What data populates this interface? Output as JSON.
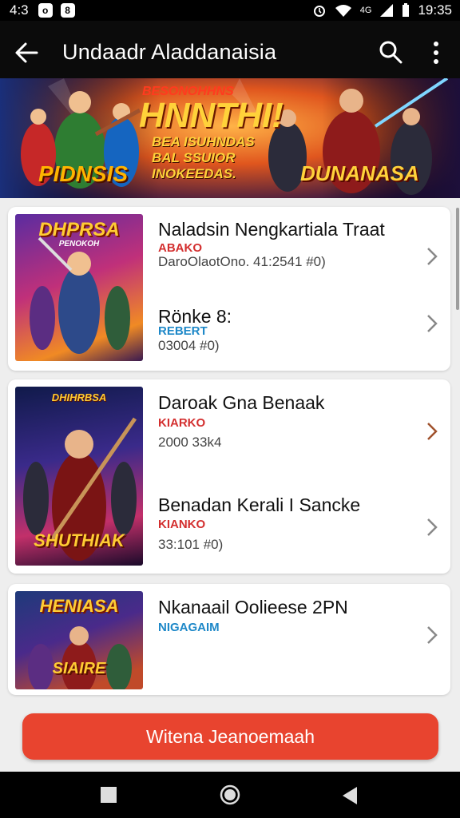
{
  "status_bar": {
    "time_left": "4:3",
    "badge1": "o",
    "badge2": "8",
    "network": "4G",
    "time_right": "19:35"
  },
  "app_bar": {
    "title": "Undaadr Aladdanaisia",
    "back_icon": "arrow-left-icon",
    "search_icon": "search-icon",
    "more_icon": "more-vert-icon"
  },
  "banner": {
    "line1": "BESONOHHNS",
    "line2": "HNNTHI!",
    "line3": "BEA ISUHNDAS",
    "line4": "BAL SSUIOR",
    "line5": "INOKEEDAS.",
    "left_logo": "PIDNSIS",
    "right_logo": "DUNANASA"
  },
  "cards": [
    {
      "thumb_title": "DHPRSA",
      "thumb_sub": "PENOKOH",
      "items": [
        {
          "title": "Naladsin Nengkartiala Traat",
          "sub": "ABAKO",
          "sub_color": "#d32f2f",
          "meta": "DaroOlaotOno. 41:2541 #0)"
        },
        {
          "title": "Rönke 8:",
          "sub": "REBERT",
          "sub_color": "#1e88c8",
          "meta": "03004 #0)"
        }
      ]
    },
    {
      "thumb_title": "DHIHRBSA",
      "thumb_sub": "SHUTHIAK",
      "items": [
        {
          "title": "Daroak Gna Benaak",
          "sub": "KIARKO",
          "sub_color": "#d32f2f",
          "meta": "2000 33k4"
        },
        {
          "title": "Benadan Kerali I Sancke",
          "sub": "KIANKO",
          "sub_color": "#d32f2f",
          "meta": "33:101 #0)"
        }
      ]
    },
    {
      "thumb_title": "HENIASA",
      "thumb_sub": "SIAIRE",
      "items": [
        {
          "title": "Nkanaail Oolieese 2PN",
          "sub": "NIGAGAIM",
          "sub_color": "#1e88c8",
          "meta": ""
        }
      ]
    }
  ],
  "cta": {
    "label": "Witena Jeanoemaah"
  },
  "nav_bar": {
    "back": "triangle-back-icon",
    "home": "circle-home-icon",
    "recents": "square-recents-icon"
  },
  "colors": {
    "accent": "#e8442f",
    "app_bar": "#0b0b0b",
    "background": "#eeeeee"
  }
}
